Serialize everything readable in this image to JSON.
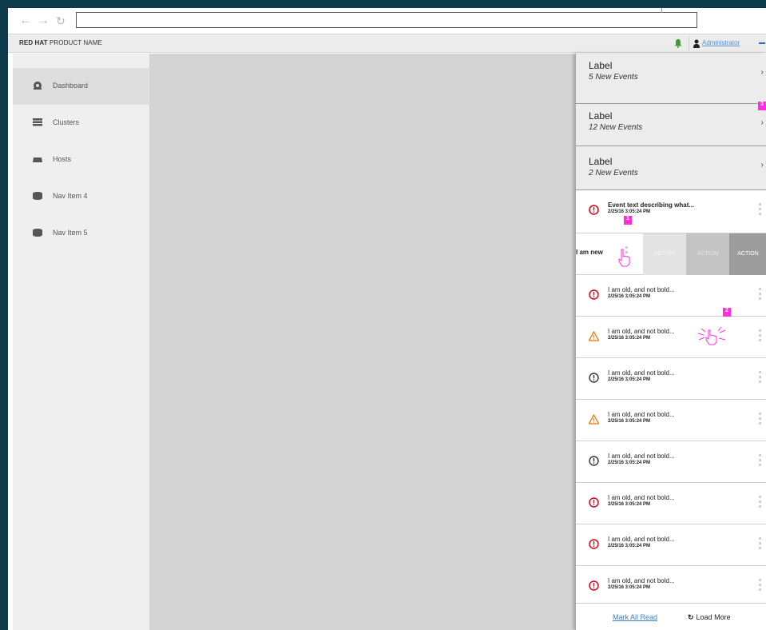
{
  "browser": {
    "url": ""
  },
  "masthead": {
    "brand_bold": "RED HAT",
    "brand_rest": " PRODUCT NAME",
    "user": "Administrator"
  },
  "sidebar": {
    "items": [
      {
        "label": "Dashboard",
        "icon": "dashboard-icon",
        "active": true
      },
      {
        "label": "Clusters",
        "icon": "clusters-icon"
      },
      {
        "label": "Hosts",
        "icon": "hosts-icon"
      },
      {
        "label": "Nav Item 4",
        "icon": "database-icon"
      },
      {
        "label": "Nav Item 5",
        "icon": "database-icon"
      }
    ]
  },
  "drawer": {
    "groups": [
      {
        "label": "Label",
        "count": "5 New Events"
      },
      {
        "label": "Label",
        "count": "12 New Events"
      },
      {
        "label": "Label",
        "count": "2 New Events"
      }
    ],
    "first_event": {
      "title": "Event text describing what...",
      "time": "2/25/16  3:05:24 PM",
      "status": "error"
    },
    "swipe": {
      "label": "I am new",
      "actions": [
        "ACTION",
        "ACTION",
        "ACTION"
      ]
    },
    "events": [
      {
        "title": "I am old, and not bold...",
        "time": "2/25/16  3:05:24 PM",
        "status": "error"
      },
      {
        "title": "I am old, and not bold...",
        "time": "2/25/16  3:05:24 PM",
        "status": "warning"
      },
      {
        "title": "I am old, and not bold...",
        "time": "2/25/16  3:05:24 PM",
        "status": "info"
      },
      {
        "title": "I am old, and not bold...",
        "time": "2/25/16  3:05:24 PM",
        "status": "warning"
      },
      {
        "title": "I am old, and not bold...",
        "time": "2/25/16  3:05:24 PM",
        "status": "info"
      },
      {
        "title": "I am old, and not bold...",
        "time": "2/25/16  3:05:24 PM",
        "status": "error"
      },
      {
        "title": "I am old, and not bold...",
        "time": "2/25/16  3:05:24 PM",
        "status": "error"
      },
      {
        "title": "I am old, and not bold...",
        "time": "2/25/16  3:05:24 PM",
        "status": "error"
      }
    ],
    "footer": {
      "mark_all": "Mark All Read",
      "load_more": "Load More"
    }
  },
  "annotations": {
    "badge_1": "1",
    "badge_2": "2",
    "badge_3": "3"
  },
  "colors": {
    "error": "#d0021b",
    "warning": "#ec7a08",
    "info": "#363636",
    "badge": "#ff2fe0",
    "accent": "#3b80c6",
    "bell": "#3f9c35"
  }
}
